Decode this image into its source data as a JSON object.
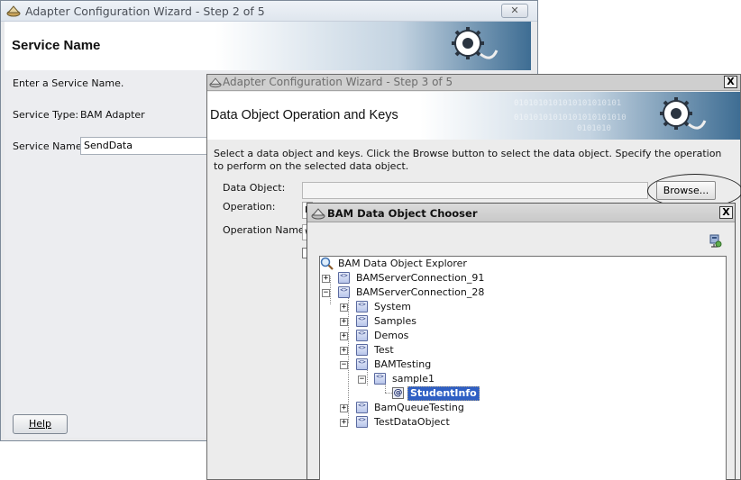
{
  "step2_window": {
    "title": "Adapter Configuration Wizard - Step 2 of 5",
    "close_glyph": "✕",
    "header": "Service Name",
    "instruction": "Enter a Service Name.",
    "service_type_label": "Service Type:",
    "service_type_value": "BAM Adapter",
    "service_name_label": "Service Name:",
    "service_name_value": "SendData",
    "help_button": "Help"
  },
  "step3_window": {
    "title": "Adapter Configuration Wizard - Step 3 of 5",
    "close_glyph": "X",
    "header": "Data Object Operation and Keys",
    "description": "Select a data object and keys.  Click the Browse button to select the data object.  Specify the operation to perform on the selected data object.",
    "data_object_label": "Data Object:",
    "operation_label": "Operation:",
    "operation_value": "I",
    "operation_name_label": "Operation Name:",
    "operation_name_value": "w",
    "browse_button": "Browse...",
    "banner_binary": [
      "0101010101010101010101",
      "01010101010101010101010",
      "0101010"
    ]
  },
  "chooser_dialog": {
    "title": "BAM Data Object Chooser",
    "close_glyph": "X",
    "tree": {
      "root": "BAM Data Object Explorer",
      "connections": [
        {
          "label": "BAMServerConnection_91",
          "expanded": false
        },
        {
          "label": "BAMServerConnection_28",
          "expanded": true
        }
      ],
      "folders": [
        {
          "label": "System",
          "expanded": false
        },
        {
          "label": "Samples",
          "expanded": false
        },
        {
          "label": "Demos",
          "expanded": false
        },
        {
          "label": "Test",
          "expanded": false
        },
        {
          "label": "BAMTesting",
          "expanded": true
        },
        {
          "label": "BamQueueTesting",
          "expanded": false
        },
        {
          "label": "TestDataObject",
          "expanded": false
        }
      ],
      "subfolder": "sample1",
      "selected_object": "StudentInfo"
    }
  },
  "colors": {
    "selection": "#2f5fc4",
    "banner_accent": "#3e6d93"
  },
  "icons": {
    "wizard_window_icon": "gear-cup-icon",
    "banner_graphic": "gear-plug-icon",
    "explorer_root": "magnifier-icon",
    "refresh": "refresh-server-icon",
    "node": "bam-node-icon",
    "data_object": "at-sign-icon"
  }
}
